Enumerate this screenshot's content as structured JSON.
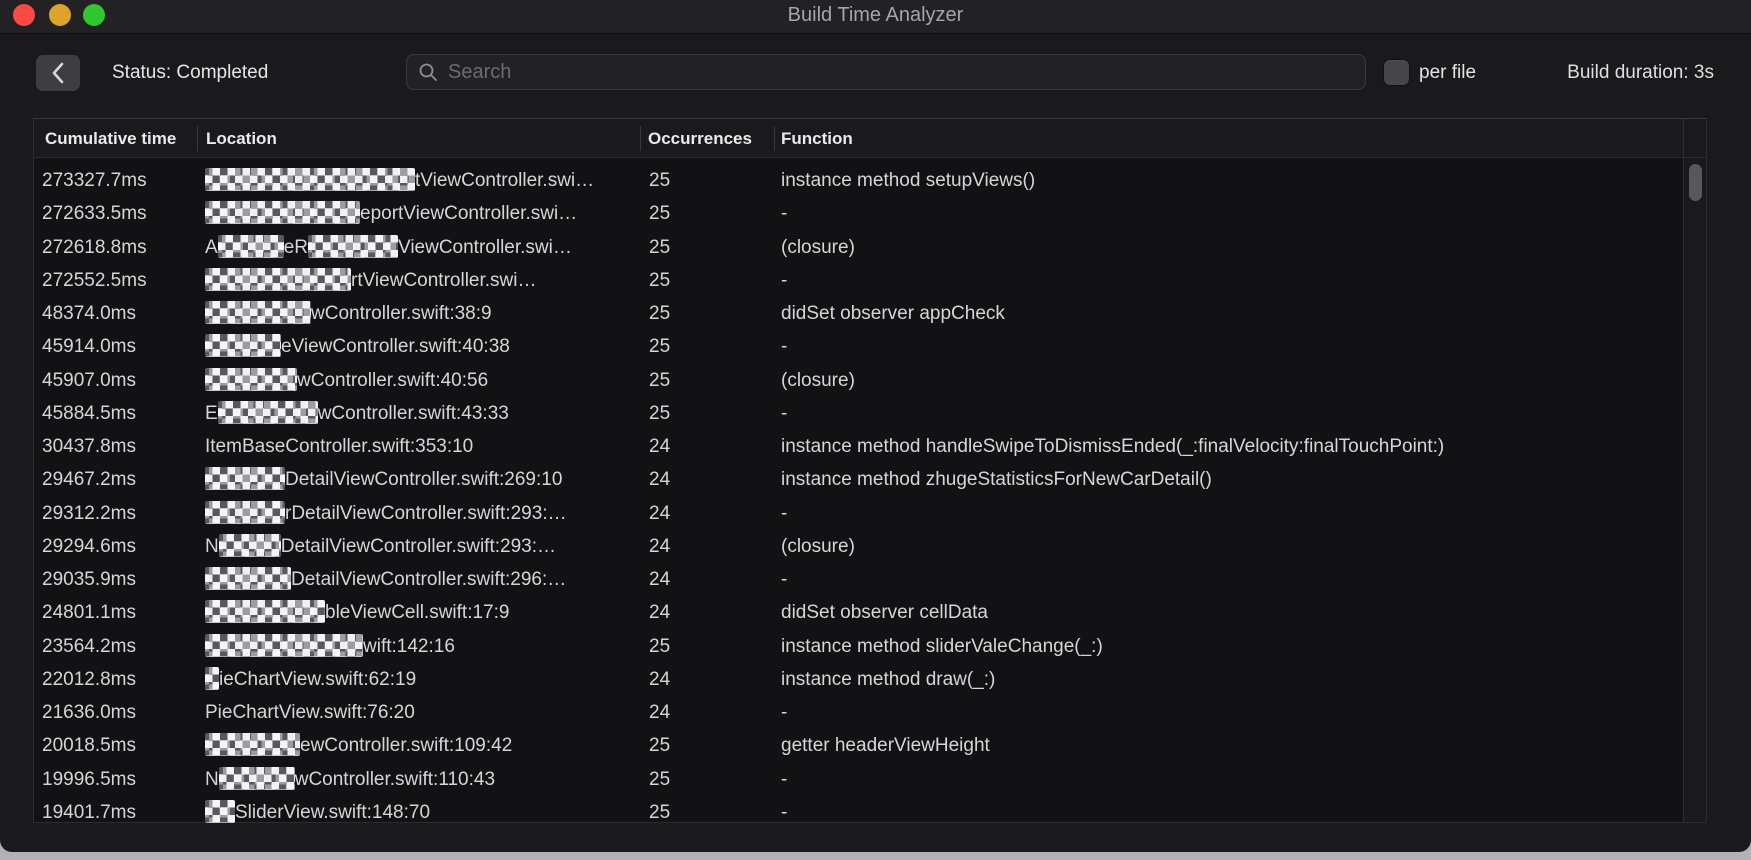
{
  "window": {
    "title": "Build Time Analyzer"
  },
  "icons": {
    "back": "chevron-left-icon",
    "search": "search-icon"
  },
  "colors": {
    "traffic_red": "#fb4a43",
    "traffic_yellow": "#dda32a",
    "traffic_green": "#2fc62f",
    "window_bg": "#1a1a1c",
    "table_bg": "#121214"
  },
  "toolbar": {
    "status_label": "Status: Completed",
    "search_placeholder": "Search",
    "per_file_label": "per file",
    "per_file_checked": false,
    "build_duration_label": "Build duration: 3s"
  },
  "table": {
    "columns": [
      "Cumulative time",
      "Location",
      "Occurrences",
      "Function"
    ],
    "rows": [
      {
        "time": "273327.7ms",
        "location": [
          {
            "redact": 210
          },
          {
            "text": "tViewController.swi…"
          }
        ],
        "occurrences": "25",
        "function": "instance method setupViews()"
      },
      {
        "time": "272633.5ms",
        "location": [
          {
            "redact": 155
          },
          {
            "text": "eportViewController.swi…"
          }
        ],
        "occurrences": "25",
        "function": "-"
      },
      {
        "time": "272618.8ms",
        "location": [
          {
            "text": "A"
          },
          {
            "redact": 66
          },
          {
            "text": "eR"
          },
          {
            "redact": 90
          },
          {
            "text": "ViewController.swi…"
          }
        ],
        "occurrences": "25",
        "function": "(closure)"
      },
      {
        "time": "272552.5ms",
        "location": [
          {
            "redact": 146
          },
          {
            "text": "rtViewController.swi…"
          }
        ],
        "occurrences": "25",
        "function": "-"
      },
      {
        "time": "48374.0ms",
        "location": [
          {
            "redact": 106
          },
          {
            "text": "wController.swift:38:9"
          }
        ],
        "occurrences": "25",
        "function": "didSet observer appCheck"
      },
      {
        "time": "45914.0ms",
        "location": [
          {
            "redact": 76
          },
          {
            "text": "eViewController.swift:40:38"
          }
        ],
        "occurrences": "25",
        "function": "-"
      },
      {
        "time": "45907.0ms",
        "location": [
          {
            "redact": 92
          },
          {
            "text": "wController.swift:40:56"
          }
        ],
        "occurrences": "25",
        "function": "(closure)"
      },
      {
        "time": "45884.5ms",
        "location": [
          {
            "text": "E"
          },
          {
            "redact": 100
          },
          {
            "text": "wController.swift:43:33"
          }
        ],
        "occurrences": "25",
        "function": "-"
      },
      {
        "time": "30437.8ms",
        "location": [
          {
            "text": "ItemBaseController.swift:353:10"
          }
        ],
        "occurrences": "24",
        "function": "instance method handleSwipeToDismissEnded(_:finalVelocity:finalTouchPoint:)"
      },
      {
        "time": "29467.2ms",
        "location": [
          {
            "redact": 80
          },
          {
            "text": "DetailViewController.swift:269:10"
          }
        ],
        "occurrences": "24",
        "function": "instance method zhugeStatisticsForNewCarDetail()"
      },
      {
        "time": "29312.2ms",
        "location": [
          {
            "redact": 80
          },
          {
            "text": "rDetailViewController.swift:293:…"
          }
        ],
        "occurrences": "24",
        "function": "-"
      },
      {
        "time": "29294.6ms",
        "location": [
          {
            "text": "N"
          },
          {
            "redact": 62
          },
          {
            "text": "DetailViewController.swift:293:…"
          }
        ],
        "occurrences": "24",
        "function": "(closure)"
      },
      {
        "time": "29035.9ms",
        "location": [
          {
            "redact": 86
          },
          {
            "text": "DetailViewController.swift:296:…"
          }
        ],
        "occurrences": "24",
        "function": "-"
      },
      {
        "time": "24801.1ms",
        "location": [
          {
            "redact": 120
          },
          {
            "text": "bleViewCell.swift:17:9"
          }
        ],
        "occurrences": "24",
        "function": "didSet observer cellData"
      },
      {
        "time": "23564.2ms",
        "location": [
          {
            "redact": 158
          },
          {
            "text": "wift:142:16"
          }
        ],
        "occurrences": "25",
        "function": "instance method sliderValeChange(_:)"
      },
      {
        "time": "22012.8ms",
        "location": [
          {
            "redact": 14
          },
          {
            "text": "ieChartView.swift:62:19"
          }
        ],
        "occurrences": "24",
        "function": "instance method draw(_:)"
      },
      {
        "time": "21636.0ms",
        "location": [
          {
            "text": "PieChartView.swift:76:20"
          }
        ],
        "occurrences": "24",
        "function": "-"
      },
      {
        "time": "20018.5ms",
        "location": [
          {
            "redact": 95
          },
          {
            "text": "ewController.swift:109:42"
          }
        ],
        "occurrences": "25",
        "function": "getter headerViewHeight"
      },
      {
        "time": "19996.5ms",
        "location": [
          {
            "text": "N"
          },
          {
            "redact": 76
          },
          {
            "text": "wController.swift:110:43"
          }
        ],
        "occurrences": "25",
        "function": "-"
      },
      {
        "time": "19401.7ms",
        "location": [
          {
            "redact": 30
          },
          {
            "text": "SliderView.swift:148:70"
          }
        ],
        "occurrences": "25",
        "function": "-"
      }
    ]
  }
}
